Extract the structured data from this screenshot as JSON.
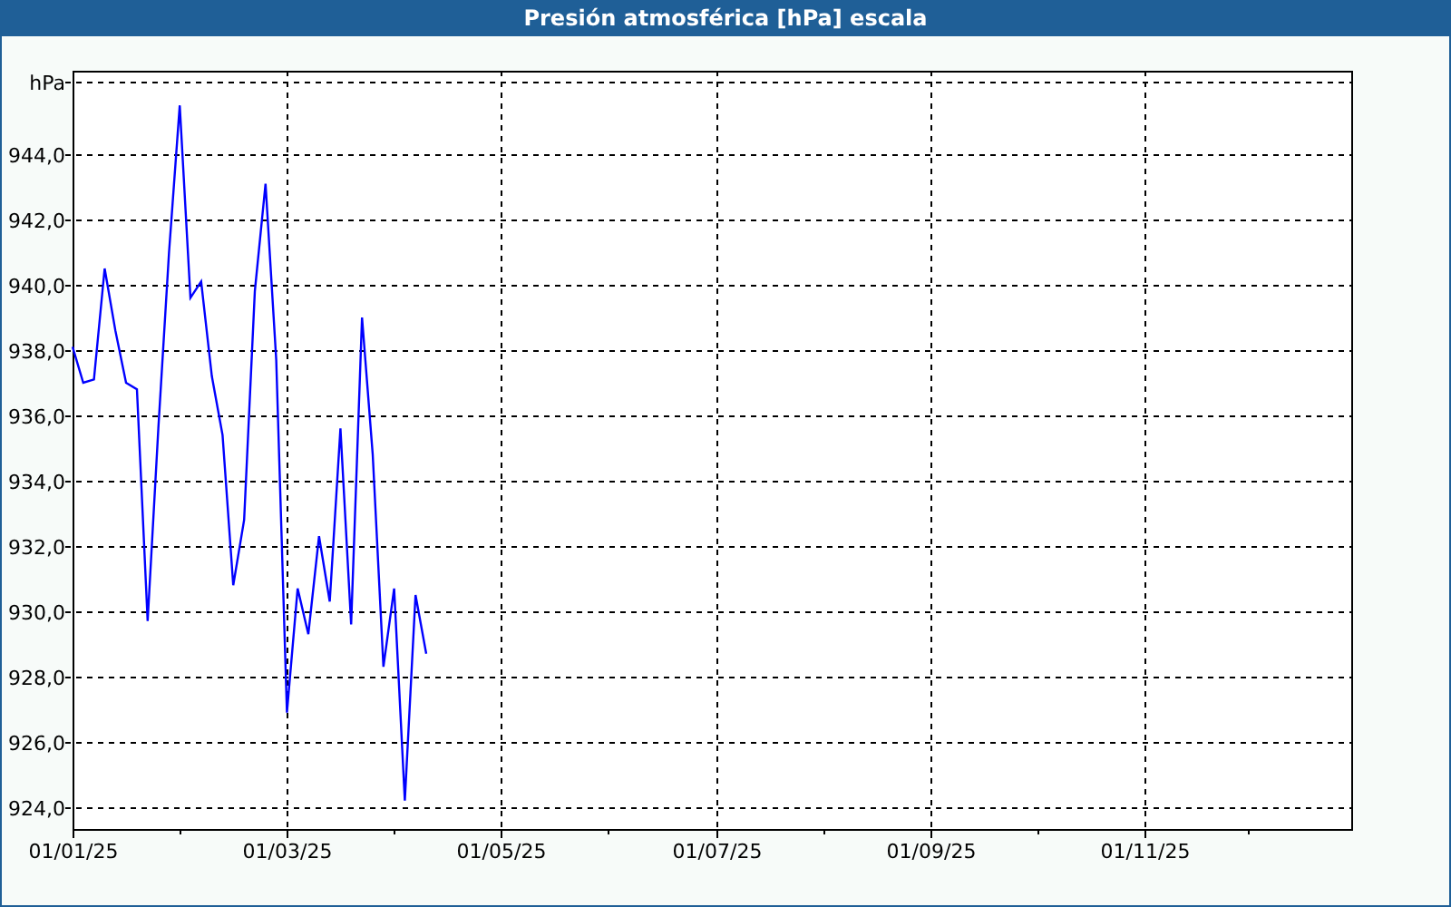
{
  "window": {
    "title": "Presión atmosférica [hPa] escala"
  },
  "chart": {
    "chart_data": {
      "type": "line",
      "grid": true,
      "ylabel": "hPa",
      "ylim": [
        923.33,
        946.56
      ],
      "categories": [
        "01/01/25",
        null,
        null,
        null,
        null,
        null,
        null,
        null,
        null,
        null,
        null,
        null,
        null,
        null,
        null,
        null,
        null,
        null,
        null,
        null,
        "01/03/25",
        null,
        null,
        null,
        null,
        null,
        null,
        null,
        null,
        null,
        null,
        null,
        null,
        null,
        null,
        null,
        null,
        null,
        null,
        null,
        "01/05/25",
        null,
        null,
        null,
        null,
        null,
        null,
        null,
        null,
        null,
        null,
        null,
        null,
        null,
        null,
        null,
        null,
        null,
        null,
        null,
        "01/07/25",
        null,
        null,
        null,
        null,
        null,
        null,
        null,
        null,
        null,
        null,
        null,
        null,
        null,
        null,
        null,
        null,
        null,
        null,
        null,
        "01/09/25",
        null,
        null,
        null,
        null,
        null,
        null,
        null,
        null,
        null,
        null,
        null,
        null,
        null,
        null,
        null,
        null,
        null,
        null,
        null,
        "01/11/25",
        null,
        null,
        null,
        null,
        null,
        null,
        null,
        null,
        null,
        null,
        null,
        null,
        null,
        null,
        null,
        null,
        null,
        null,
        null
      ],
      "yticks": [
        {
          "value": 924,
          "label": "924,0"
        },
        {
          "value": 926,
          "label": "926,0"
        },
        {
          "value": 928,
          "label": "928,0"
        },
        {
          "value": 930,
          "label": "930,0"
        },
        {
          "value": 932,
          "label": "932,0"
        },
        {
          "value": 934,
          "label": "934,0"
        },
        {
          "value": 936,
          "label": "936,0"
        },
        {
          "value": 938,
          "label": "938,0"
        },
        {
          "value": 940,
          "label": "940,0"
        },
        {
          "value": 942,
          "label": "942,0"
        },
        {
          "value": 944,
          "label": "944,0"
        }
      ],
      "series": [
        {
          "color": "#0000ff",
          "values": [
            938.1,
            937.0,
            937.1,
            940.5,
            938.6,
            937.0,
            936.8,
            929.7,
            935.6,
            941.0,
            945.5,
            939.6,
            940.1,
            937.2,
            935.4,
            930.8,
            932.8,
            939.8,
            943.1,
            937.7,
            926.9,
            930.7,
            929.3,
            932.3,
            930.3,
            935.6,
            929.6,
            939.0,
            934.8,
            928.3,
            930.7,
            924.2,
            930.5,
            928.7,
            null,
            null,
            null,
            null,
            null,
            null,
            null,
            null,
            null,
            null,
            null,
            null,
            null,
            null,
            null,
            null,
            null,
            null,
            null,
            null,
            null,
            null,
            null,
            null,
            null,
            null,
            null,
            null,
            null,
            null,
            null,
            null,
            null,
            null,
            null,
            null,
            null,
            null,
            null,
            null,
            null,
            null,
            null,
            null,
            null,
            null,
            null,
            null,
            null,
            null,
            null,
            null,
            null,
            null,
            null,
            null,
            null,
            null,
            null,
            null,
            null,
            null,
            null,
            null,
            null,
            null,
            null,
            null,
            null,
            null,
            null,
            null,
            null,
            null,
            null,
            null,
            null,
            null,
            null,
            null,
            null,
            null,
            null,
            null,
            null,
            null
          ]
        }
      ]
    }
  }
}
